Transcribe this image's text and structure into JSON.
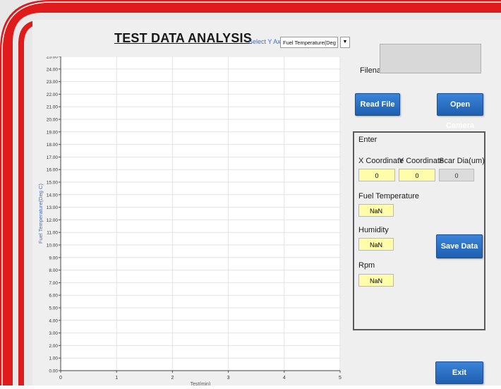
{
  "title": "TEST DATA ANALYSIS",
  "select_y_axis": {
    "label": "Select Y Axis",
    "value": "Fuel Temperature(Deg C)"
  },
  "filename": {
    "label": "Filename",
    "value": ""
  },
  "buttons": {
    "read_file": "Read File",
    "open_camera": "Open Camera",
    "save_data": "Save Data",
    "exit": "Exit"
  },
  "entry": {
    "enter_label": "Enter",
    "x_coordinate": {
      "label": "X Coordinate",
      "value": "0"
    },
    "y_coordinate": {
      "label": "Y Coordinate",
      "value": "0"
    },
    "scar_dia": {
      "label": "Scar Dia(um)",
      "value": "0"
    },
    "fuel_temperature": {
      "label": "Fuel Temperature",
      "value": "NaN"
    },
    "humidity": {
      "label": "Humidity",
      "value": "NaN"
    },
    "rpm": {
      "label": "Rpm",
      "value": "NaN"
    }
  },
  "colors": {
    "accent_red": "#e01b1b",
    "button_blue": "#2a6fc4",
    "field_yellow": "#fffcaa",
    "axis_label_blue": "#3b6fd4"
  },
  "chart_data": {
    "type": "line",
    "ylabel": "Fuel Temperature(Deg C)",
    "xlabel": "Test(min)",
    "xlim": [
      0,
      5
    ],
    "ylim": [
      0,
      25
    ],
    "x_ticks": [
      "0",
      "1",
      "2",
      "3",
      "4",
      "5"
    ],
    "y_ticks": [
      "0.00",
      "1.00",
      "2.00",
      "3.00",
      "4.00",
      "5.00",
      "6.00",
      "7.00",
      "8.00",
      "9.00",
      "10.00",
      "11.00",
      "12.00",
      "13.00",
      "14.00",
      "15.00",
      "16.00",
      "17.00",
      "18.00",
      "19.00",
      "20.00",
      "21.00",
      "22.00",
      "23.00",
      "24.00",
      "25.00"
    ],
    "grid": true,
    "series": []
  }
}
